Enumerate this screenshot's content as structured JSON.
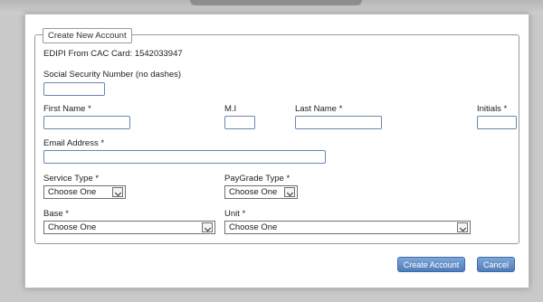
{
  "form": {
    "legend": "Create New Account",
    "edipi_label": "EDIPI From CAC Card:",
    "edipi_value": "1542033947",
    "ssn_label": "Social Security Number (no dashes)",
    "first_name_label": "First Name *",
    "mi_label": "M.I",
    "last_name_label": "Last Name *",
    "initials_label": "Initials *",
    "email_label": "Email Address *",
    "service_type_label": "Service Type *",
    "service_type_value": "Choose One",
    "paygrade_label": "PayGrade Type *",
    "paygrade_value": "Choose One",
    "base_label": "Base *",
    "base_value": "Choose One",
    "unit_label": "Unit *",
    "unit_value": "Choose One"
  },
  "buttons": {
    "create": "Create Account",
    "cancel": "Cancel"
  },
  "colors": {
    "button_top": "#7fa6d6",
    "button_bottom": "#4d7cbc",
    "input_border": "#6a86b0"
  }
}
